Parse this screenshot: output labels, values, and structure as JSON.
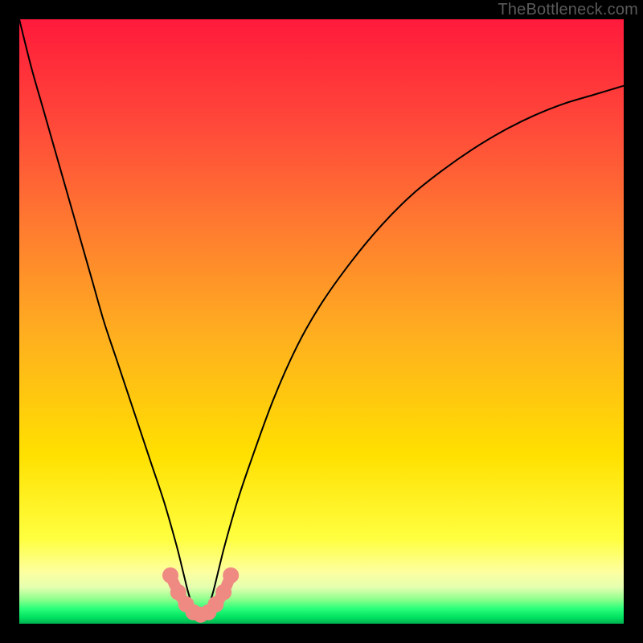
{
  "attribution": "TheBottleneck.com",
  "chart_data": {
    "type": "line",
    "title": "",
    "xlabel": "",
    "ylabel": "",
    "xlim": [
      0,
      100
    ],
    "ylim": [
      0,
      100
    ],
    "grid": false,
    "legend": false,
    "series": [
      {
        "name": "bottleneck-curve",
        "color": "#000000",
        "x": [
          0,
          2,
          4,
          6,
          8,
          10,
          12,
          14,
          16,
          18,
          20,
          22,
          24,
          26,
          27,
          28,
          29,
          30,
          31,
          32,
          33,
          34,
          36,
          38,
          42,
          46,
          50,
          55,
          60,
          65,
          70,
          75,
          80,
          85,
          90,
          95,
          100
        ],
        "y": [
          100,
          92,
          85,
          78,
          71,
          64,
          57,
          50,
          44,
          38,
          32,
          26,
          20,
          13,
          9,
          5,
          2,
          1,
          2,
          5,
          9,
          13,
          20,
          26,
          37,
          46,
          53,
          60,
          66,
          71,
          75,
          78.5,
          81.5,
          84,
          86,
          87.5,
          89
        ]
      },
      {
        "name": "bottleneck-dots",
        "color": "#ef8a83",
        "x": [
          25.0,
          26.3,
          27.6,
          28.8,
          30.0,
          31.3,
          32.5,
          33.8,
          35.0
        ],
        "y": [
          8.0,
          5.2,
          3.2,
          1.9,
          1.5,
          1.9,
          3.2,
          5.2,
          8.0
        ]
      }
    ],
    "annotations": []
  }
}
